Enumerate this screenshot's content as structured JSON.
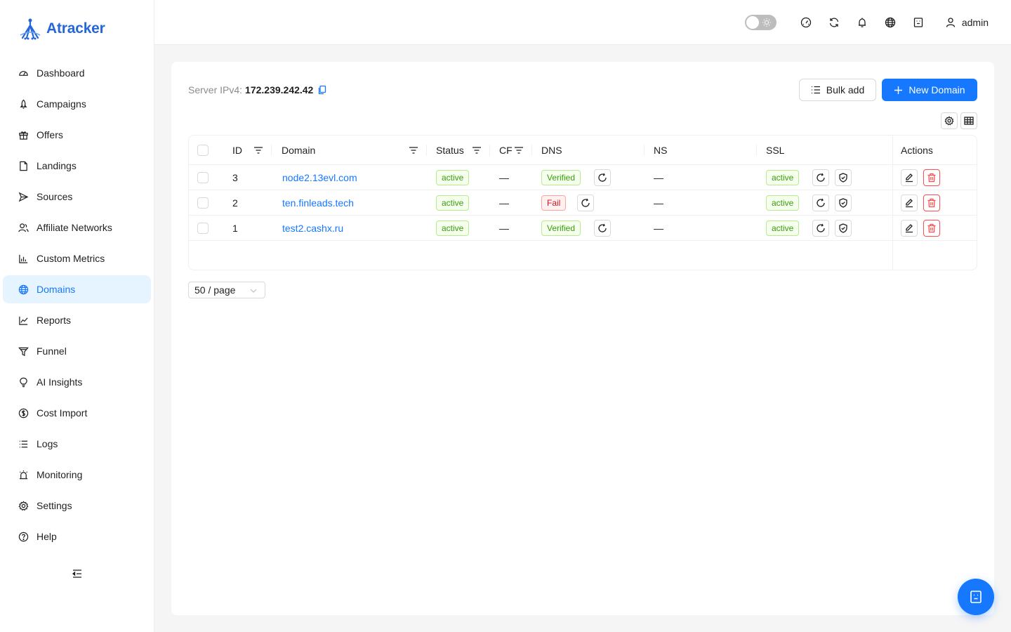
{
  "app": {
    "logo_text": "Atracker"
  },
  "sidebar": {
    "items": [
      {
        "label": "Dashboard",
        "icon": "dashboard-icon"
      },
      {
        "label": "Campaigns",
        "icon": "rocket-icon"
      },
      {
        "label": "Offers",
        "icon": "gift-icon"
      },
      {
        "label": "Landings",
        "icon": "file-icon"
      },
      {
        "label": "Sources",
        "icon": "send-icon"
      },
      {
        "label": "Affiliate Networks",
        "icon": "users-icon"
      },
      {
        "label": "Custom Metrics",
        "icon": "bar-chart-icon"
      },
      {
        "label": "Domains",
        "icon": "globe-icon",
        "active": true
      },
      {
        "label": "Reports",
        "icon": "line-chart-icon"
      },
      {
        "label": "Funnel",
        "icon": "funnel-icon"
      },
      {
        "label": "AI Insights",
        "icon": "bulb-icon"
      },
      {
        "label": "Cost Import",
        "icon": "dollar-icon"
      },
      {
        "label": "Logs",
        "icon": "list-icon"
      },
      {
        "label": "Monitoring",
        "icon": "alarm-icon"
      },
      {
        "label": "Settings",
        "icon": "gear-icon"
      },
      {
        "label": "Help",
        "icon": "question-icon"
      }
    ]
  },
  "header": {
    "user_name": "admin"
  },
  "main": {
    "server_label": "Server IPv4:",
    "server_ip": "172.239.242.42",
    "bulk_add_label": "Bulk add",
    "new_domain_label": "New Domain",
    "table": {
      "columns": {
        "id": "ID",
        "domain": "Domain",
        "status": "Status",
        "cf": "CF",
        "dns": "DNS",
        "ns": "NS",
        "ssl": "SSL",
        "actions": "Actions"
      },
      "rows": [
        {
          "id": "3",
          "domain": "node2.13evl.com",
          "status": "active",
          "cf": "—",
          "dns": "Verified",
          "dns_ok": true,
          "ns": "—",
          "ssl": "active"
        },
        {
          "id": "2",
          "domain": "ten.finleads.tech",
          "status": "active",
          "cf": "—",
          "dns": "Fail",
          "dns_ok": false,
          "ns": "—",
          "ssl": "active"
        },
        {
          "id": "1",
          "domain": "test2.cashx.ru",
          "status": "active",
          "cf": "—",
          "dns": "Verified",
          "dns_ok": true,
          "ns": "—",
          "ssl": "active"
        }
      ]
    },
    "page_size": "50 / page"
  },
  "colors": {
    "accent": "#1677ff",
    "brand": "#2566d9",
    "success": "#389e0d",
    "danger": "#cf1322"
  }
}
